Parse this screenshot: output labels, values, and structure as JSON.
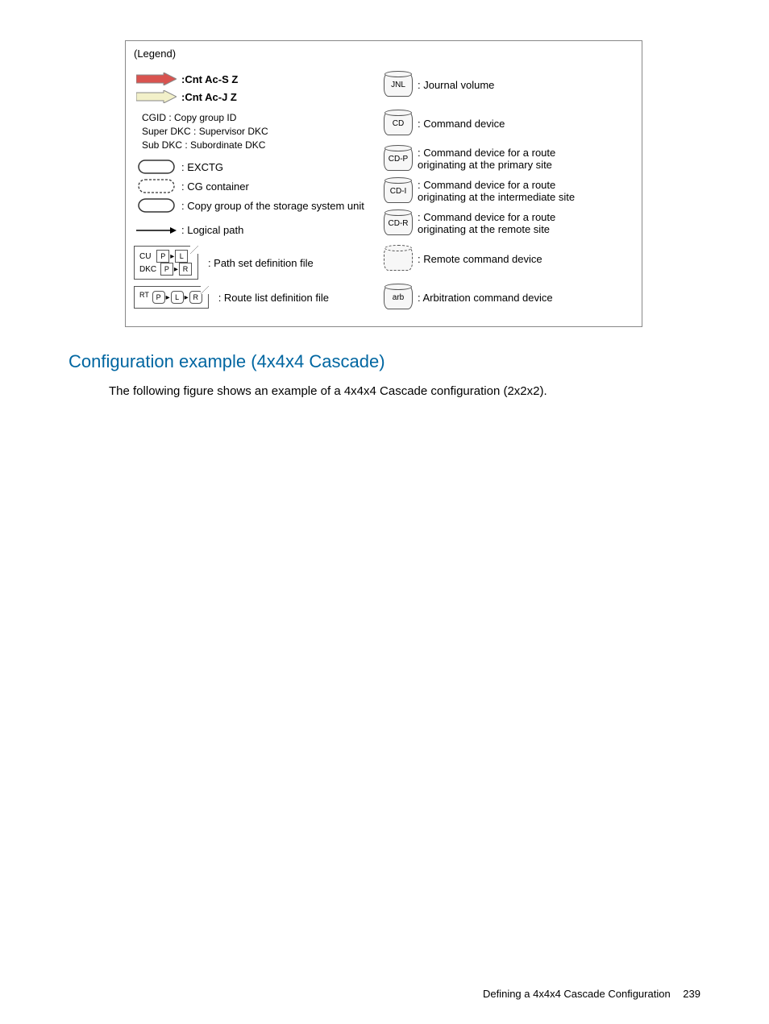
{
  "legend": {
    "title": "(Legend)",
    "left": {
      "cnt_ac_s": ":Cnt Ac-S Z",
      "cnt_ac_j": ":Cnt Ac-J Z",
      "lines": [
        "CGID : Copy group ID",
        "Super DKC : Supervisor DKC",
        "Sub DKC : Subordinate DKC"
      ],
      "exctg": ": EXCTG",
      "cg_container": ": CG container",
      "copy_group": ": Copy group of the storage system unit",
      "logical_path": ": Logical path",
      "path_set_label": ": Path set definition file",
      "path_set_cu": "CU",
      "path_set_dkc": "DKC",
      "route_list_label": ": Route list definition file",
      "route_list_rt": "RT",
      "box_p": "P",
      "box_l": "L",
      "box_r": "R"
    },
    "right": {
      "jnl_sym": "JNL",
      "jnl": ": Journal volume",
      "cd_sym": "CD",
      "cd": ": Command device",
      "cdp_sym": "CD-P",
      "cdp": ": Command device for a route originating at the primary site",
      "cdi_sym": "CD-I",
      "cdi": ": Command device for a route originating at the intermediate site",
      "cdr_sym": "CD-R",
      "cdr": ": Command device for a route originating at the remote site",
      "remote_cd": ": Remote command device",
      "arb_sym": "arb",
      "arb": ": Arbitration command device"
    }
  },
  "heading": "Configuration example (4x4x4 Cascade)",
  "body": "The following figure shows an example of a 4x4x4 Cascade configuration (2x2x2).",
  "footer": {
    "section": "Defining a 4x4x4 Cascade Configuration",
    "page": "239"
  }
}
